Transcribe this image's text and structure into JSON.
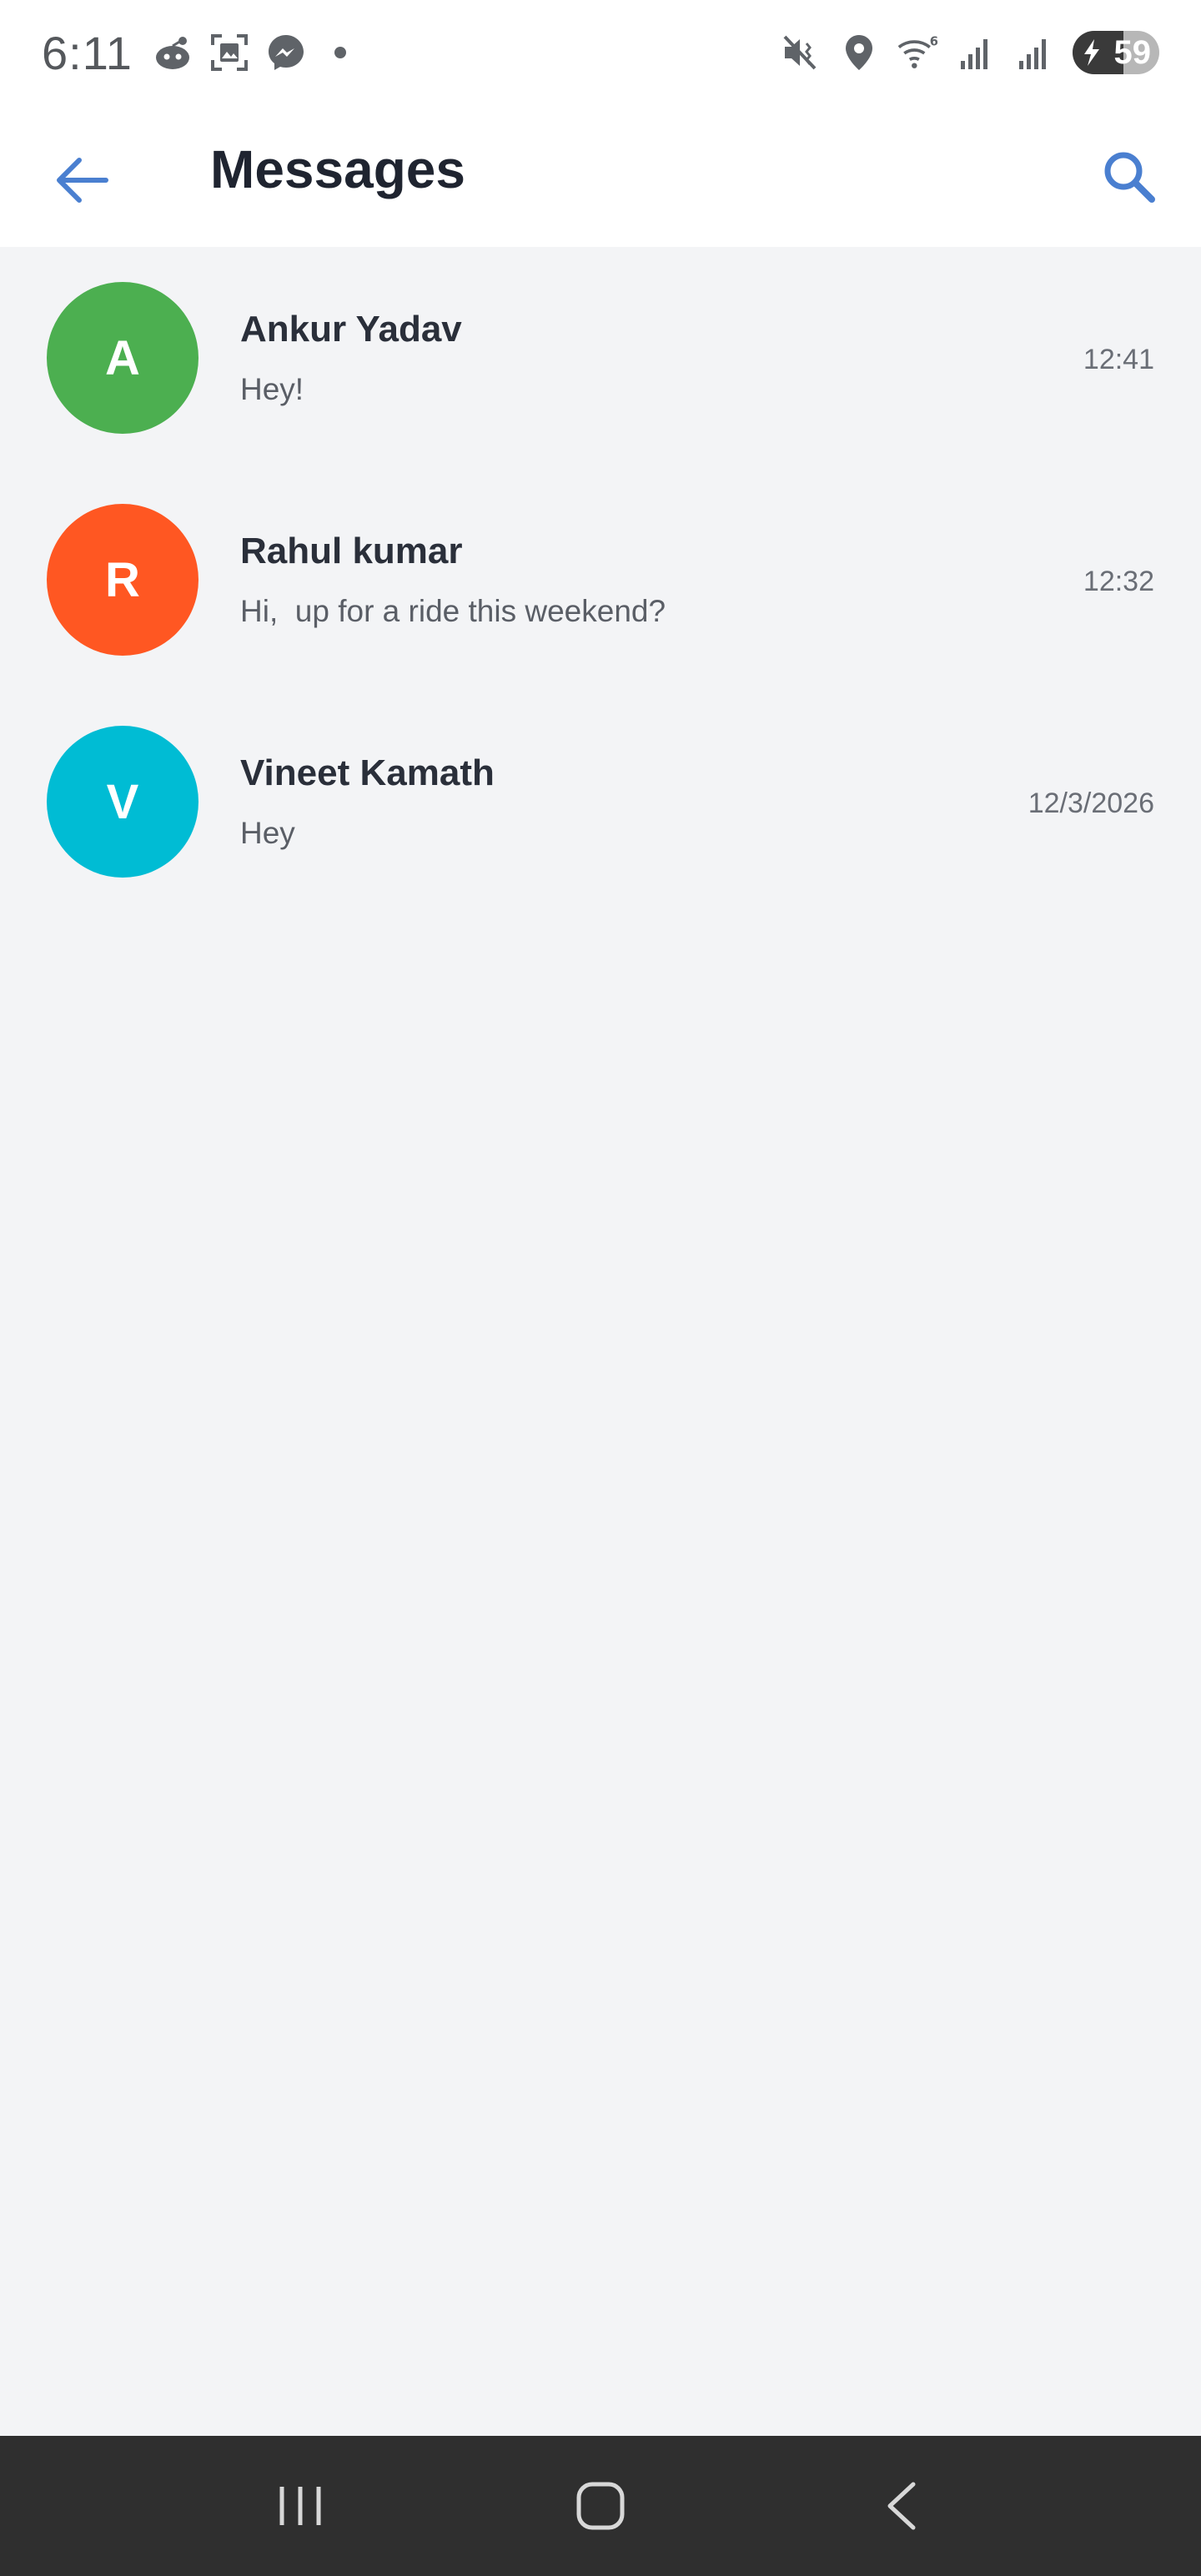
{
  "status_bar": {
    "time": "6:11",
    "battery_level": "59",
    "battery_fraction": 0.59,
    "left_icons": [
      "reddit-icon",
      "screenshot-icon",
      "messenger-icon",
      "notification-dot"
    ],
    "right_icons": [
      "mute-vibrate-icon",
      "location-icon",
      "wifi-6-icon",
      "signal-icon",
      "signal-icon"
    ]
  },
  "header": {
    "title": "Messages",
    "back_icon": "arrow-left-icon",
    "search_icon": "search-icon"
  },
  "colors": {
    "accent": "#4a7fd0",
    "background": "#f3f4f6"
  },
  "conversations": [
    {
      "initial": "A",
      "name": "Ankur Yadav",
      "preview": "Hey!",
      "time": "12:41",
      "avatar_color": "#4caf50"
    },
    {
      "initial": "R",
      "name": "Rahul kumar",
      "preview": "Hi,  up for a ride this weekend?",
      "time": "12:32",
      "avatar_color": "#ff5722"
    },
    {
      "initial": "V",
      "name": "Vineet Kamath",
      "preview": "Hey",
      "time": "12/3/2026",
      "avatar_color": "#00bcd4"
    }
  ],
  "nav_bar": {
    "buttons": [
      "recents-icon",
      "home-icon",
      "back-icon"
    ]
  }
}
